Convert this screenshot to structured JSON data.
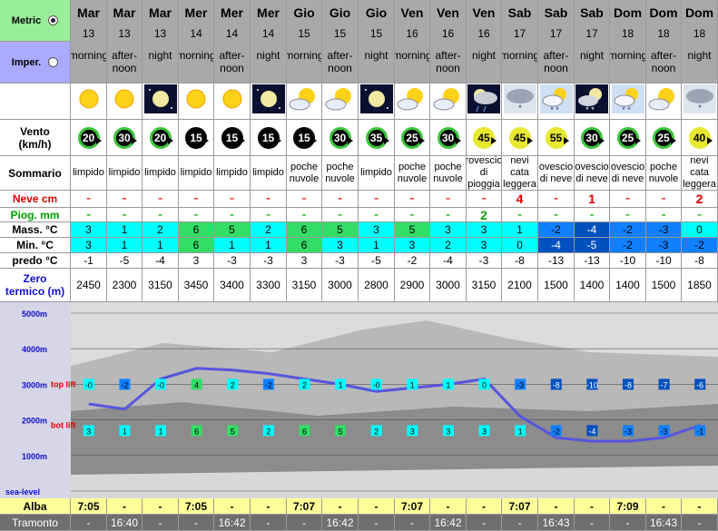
{
  "units": {
    "metric": "Metric",
    "imperial": "Imper.",
    "selected": "metric"
  },
  "labels": {
    "wind": "Vento",
    "wind_unit": "(km/h)",
    "summary": "Sommario",
    "snow": "Neve cm",
    "rain": "Piog. mm",
    "max": "Mass. °C",
    "min": "Min. °C",
    "chill": "predo °C",
    "freeze": "Zero",
    "freeze2": "termico (m)",
    "sunrise": "Alba",
    "sunset": "Tramonto"
  },
  "columns": [
    {
      "day": "Mar",
      "date": "13",
      "period": "morning",
      "icon": "sunny-icon",
      "wind": "20",
      "wind_color": "#3cc43c",
      "summary": "limpido",
      "snow": "-",
      "rain": "-",
      "max": "3",
      "min": "3",
      "chill": "-1",
      "freeze": "2450",
      "top_lift": "-0",
      "bot_lift": "3",
      "sunrise": "7:05",
      "sunset": "-"
    },
    {
      "day": "Mar",
      "date": "13",
      "period": "after-noon",
      "icon": "sunny-icon",
      "wind": "30",
      "wind_color": "#3cc43c",
      "summary": "limpido",
      "snow": "-",
      "rain": "-",
      "max": "1",
      "min": "1",
      "chill": "-5",
      "freeze": "2300",
      "top_lift": "-2",
      "bot_lift": "1",
      "sunrise": "-",
      "sunset": "16:40"
    },
    {
      "day": "Mar",
      "date": "13",
      "period": "night",
      "icon": "clear-night-icon",
      "wind": "20",
      "wind_color": "#3cc43c",
      "summary": "limpido",
      "snow": "-",
      "rain": "-",
      "max": "2",
      "min": "1",
      "chill": "-4",
      "freeze": "3150",
      "top_lift": "-0",
      "bot_lift": "1",
      "sunrise": "-",
      "sunset": "-"
    },
    {
      "day": "Mer",
      "date": "14",
      "period": "morning",
      "icon": "sunny-icon",
      "wind": "15",
      "wind_color": "#000000",
      "summary": "limpido",
      "snow": "-",
      "rain": "-",
      "max": "6",
      "min": "6",
      "chill": "3",
      "freeze": "3450",
      "top_lift": "4",
      "bot_lift": "6",
      "sunrise": "7:05",
      "sunset": "-"
    },
    {
      "day": "Mer",
      "date": "14",
      "period": "after-noon",
      "icon": "sunny-icon",
      "wind": "15",
      "wind_color": "#000000",
      "summary": "limpido",
      "snow": "-",
      "rain": "-",
      "max": "5",
      "min": "1",
      "chill": "-3",
      "freeze": "3400",
      "top_lift": "2",
      "bot_lift": "5",
      "sunrise": "-",
      "sunset": "16:42"
    },
    {
      "day": "Mer",
      "date": "14",
      "period": "night",
      "icon": "clear-night-icon",
      "wind": "15",
      "wind_color": "#000000",
      "summary": "limpido",
      "snow": "-",
      "rain": "-",
      "max": "2",
      "min": "1",
      "chill": "-3",
      "freeze": "3300",
      "top_lift": "-2",
      "bot_lift": "2",
      "sunrise": "-",
      "sunset": "-"
    },
    {
      "day": "Gio",
      "date": "15",
      "period": "morning",
      "icon": "partly-cloudy-icon",
      "wind": "15",
      "wind_color": "#000000",
      "summary": "poche nuvole",
      "snow": "-",
      "rain": "-",
      "max": "6",
      "min": "6",
      "chill": "3",
      "freeze": "3150",
      "top_lift": "2",
      "bot_lift": "6",
      "sunrise": "7:07",
      "sunset": "-"
    },
    {
      "day": "Gio",
      "date": "15",
      "period": "after-noon",
      "icon": "partly-cloudy-icon",
      "wind": "30",
      "wind_color": "#3cc43c",
      "summary": "poche nuvole",
      "snow": "-",
      "rain": "-",
      "max": "5",
      "min": "3",
      "chill": "-3",
      "freeze": "3000",
      "top_lift": "1",
      "bot_lift": "5",
      "sunrise": "-",
      "sunset": "16:42"
    },
    {
      "day": "Gio",
      "date": "15",
      "period": "night",
      "icon": "clear-night-icon",
      "wind": "35",
      "wind_color": "#3cc43c",
      "summary": "limpido",
      "snow": "-",
      "rain": "-",
      "max": "3",
      "min": "1",
      "chill": "-5",
      "freeze": "2800",
      "top_lift": "-0",
      "bot_lift": "2",
      "sunrise": "-",
      "sunset": "-"
    },
    {
      "day": "Ven",
      "date": "16",
      "period": "morning",
      "icon": "partly-cloudy-icon",
      "wind": "25",
      "wind_color": "#3cc43c",
      "summary": "poche nuvole",
      "snow": "-",
      "rain": "-",
      "max": "5",
      "min": "3",
      "chill": "-2",
      "freeze": "2900",
      "top_lift": "1",
      "bot_lift": "3",
      "sunrise": "7:07",
      "sunset": "-"
    },
    {
      "day": "Ven",
      "date": "16",
      "period": "after-noon",
      "icon": "partly-cloudy-icon",
      "wind": "30",
      "wind_color": "#3cc43c",
      "summary": "poche nuvole",
      "snow": "-",
      "rain": "-",
      "max": "3",
      "min": "2",
      "chill": "-4",
      "freeze": "3000",
      "top_lift": "1",
      "bot_lift": "3",
      "sunrise": "-",
      "sunset": "16:42"
    },
    {
      "day": "Ven",
      "date": "16",
      "period": "night",
      "icon": "rain-shower-night-icon",
      "wind": "45",
      "wind_color": "#e8e830",
      "summary": "rovescio di pioggia",
      "snow": "-",
      "rain": "2",
      "max": "3",
      "min": "3",
      "chill": "-3",
      "freeze": "3150",
      "top_lift": "0",
      "bot_lift": "3",
      "sunrise": "-",
      "sunset": "-"
    },
    {
      "day": "Sab",
      "date": "17",
      "period": "morning",
      "icon": "light-snow-icon",
      "wind": "45",
      "wind_color": "#e8e830",
      "summary": "nevi cata leggera",
      "snow": "4",
      "rain": "-",
      "max": "1",
      "min": "0",
      "chill": "-8",
      "freeze": "2100",
      "top_lift": "-3",
      "bot_lift": "1",
      "sunrise": "7:07",
      "sunset": "-"
    },
    {
      "day": "Sab",
      "date": "17",
      "period": "after-noon",
      "icon": "snow-shower-icon",
      "wind": "55",
      "wind_color": "#e8e830",
      "summary": "ovescio di neve",
      "snow": "-",
      "rain": "-",
      "max": "-2",
      "min": "-4",
      "chill": "-13",
      "freeze": "1500",
      "top_lift": "-8",
      "bot_lift": "-2",
      "sunrise": "-",
      "sunset": "16:43"
    },
    {
      "day": "Sab",
      "date": "17",
      "period": "night",
      "icon": "snow-night-icon",
      "wind": "30",
      "wind_color": "#3cc43c",
      "summary": "ovescio di neve",
      "snow": "1",
      "rain": "-",
      "max": "-4",
      "min": "-5",
      "chill": "-13",
      "freeze": "1400",
      "top_lift": "-10",
      "bot_lift": "-4",
      "sunrise": "-",
      "sunset": "-"
    },
    {
      "day": "Dom",
      "date": "18",
      "period": "morning",
      "icon": "snow-shower-icon",
      "wind": "25",
      "wind_color": "#3cc43c",
      "summary": "ovescio di neve",
      "snow": "-",
      "rain": "-",
      "max": "-2",
      "min": "-2",
      "chill": "-10",
      "freeze": "1400",
      "top_lift": "-8",
      "bot_lift": "-3",
      "sunrise": "7:09",
      "sunset": "-"
    },
    {
      "day": "Dom",
      "date": "18",
      "period": "after-noon",
      "icon": "partly-cloudy-icon",
      "wind": "25",
      "wind_color": "#3cc43c",
      "summary": "poche nuvole",
      "snow": "-",
      "rain": "-",
      "max": "-3",
      "min": "-3",
      "chill": "-10",
      "freeze": "1500",
      "top_lift": "-7",
      "bot_lift": "-3",
      "sunrise": "-",
      "sunset": "16:43"
    },
    {
      "day": "Dom",
      "date": "18",
      "period": "night",
      "icon": "light-snow-icon",
      "wind": "40",
      "wind_color": "#e8e830",
      "summary": "nevi cata leggera",
      "snow": "2",
      "rain": "-",
      "max": "0",
      "min": "-2",
      "chill": "-8",
      "freeze": "1850",
      "top_lift": "-6",
      "bot_lift": "-1",
      "sunrise": "-",
      "sunset": "-"
    }
  ],
  "chart_data": {
    "type": "line",
    "y_axis_labels": [
      "5000m",
      "4000m",
      "3000m",
      "2000m",
      "1000m",
      "sea-level"
    ],
    "y_ticks": [
      5000,
      4000,
      3000,
      2000,
      1000,
      0
    ],
    "top_lift_label": "top lift",
    "bot_lift_label": "bot lift",
    "top_lift_altitude": 3000,
    "bot_lift_altitude": 1700,
    "ylim": [
      0,
      5500
    ],
    "series": [
      {
        "values": [
          2450,
          2300,
          3150,
          3450,
          3400,
          3300,
          3150,
          3000,
          2800,
          2900,
          3000,
          3150,
          2100,
          1500,
          1400,
          1400,
          1500,
          1850
        ]
      }
    ]
  },
  "colors": {
    "header_bg": "#a9a9a9",
    "metric_bg": "#99ee99",
    "imper_bg": "#aaaaff",
    "cyan": "#00ffff",
    "green": "#33dd66",
    "blue1": "#1080ff",
    "blue2": "#0050c0",
    "line": "#5555dd"
  }
}
